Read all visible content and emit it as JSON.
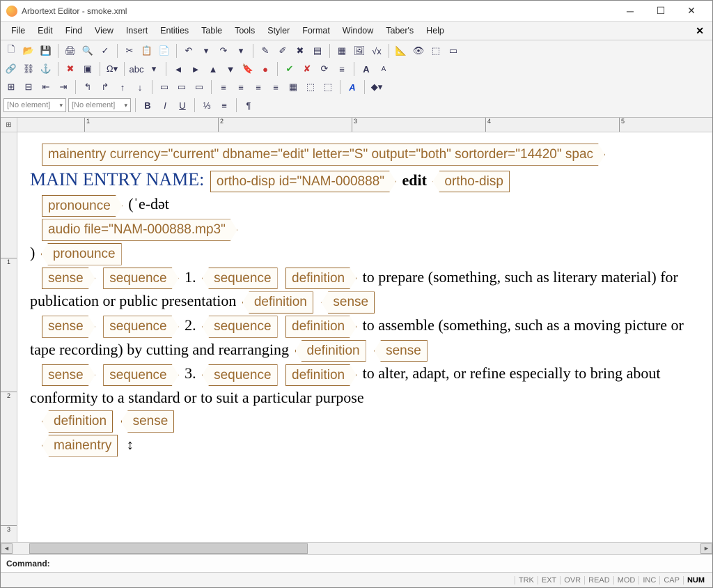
{
  "title": "Arbortext Editor - smoke.xml",
  "menu": [
    "File",
    "Edit",
    "Find",
    "View",
    "Insert",
    "Entities",
    "Table",
    "Tools",
    "Styler",
    "Format",
    "Window",
    "Taber's",
    "Help"
  ],
  "element_combo": "[No element]",
  "command_label": "Command:",
  "status_items": [
    "TRK",
    "EXT",
    "OVR",
    "READ",
    "MOD",
    "INC",
    "CAP",
    "NUM"
  ],
  "status_active": "NUM",
  "ruler_ticks": [
    1,
    2,
    3,
    4,
    5
  ],
  "doc": {
    "mainentry_tag": "mainentry currency=\"current\" dbname=\"edit\" letter=\"S\" output=\"both\" sortorder=\"14420\" spac",
    "main_entry_label": "MAIN ENTRY NAME:",
    "ortho_open": "ortho-disp id=\"NAM-000888\"",
    "ortho_text": "edit",
    "ortho_close": "ortho-disp",
    "pronounce_open": "pronounce",
    "pronounce_text": "(ˈe-dət",
    "audio_tag": "audio file=\"NAM-000888.mp3\"",
    "close_paren": ")",
    "pronounce_close": "pronounce",
    "senses": [
      {
        "num": "1.",
        "def": "to prepare (something, such as literary material) for publication or public presentation"
      },
      {
        "num": "2.",
        "def": "to assemble (something, such as a moving picture or tape recording) by cutting and rearranging"
      },
      {
        "num": "3.",
        "def": "to alter, adapt, or refine especially to bring about conformity to a standard or to suit a particular purpose"
      }
    ],
    "t_sense": "sense",
    "t_sequence": "sequence",
    "t_definition": "definition",
    "t_mainentry": "mainentry"
  }
}
